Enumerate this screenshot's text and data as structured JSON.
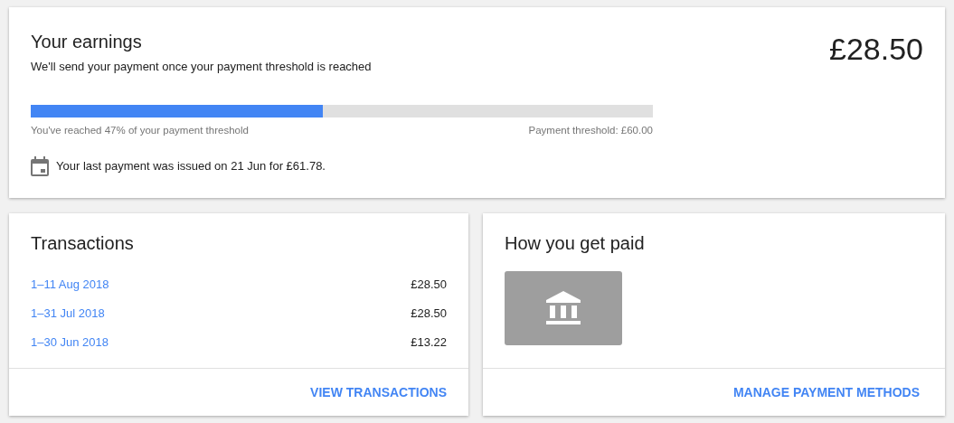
{
  "earnings": {
    "title": "Your earnings",
    "subtitle": "We'll send your payment once your payment threshold is reached",
    "amount": "£28.50",
    "progress": {
      "level": 0.47,
      "reached_text": "You've reached 47% of your payment threshold",
      "threshold_text": "Payment threshold: £60.00"
    },
    "last_payment": "Your last payment was issued on 21 Jun for £61.78."
  },
  "transactions": {
    "title": "Transactions",
    "rows": [
      {
        "period": "1–11 Aug 2018",
        "amount": "£28.50"
      },
      {
        "period": "1–31 Jul 2018",
        "amount": "£28.50"
      },
      {
        "period": "1–30 Jun 2018",
        "amount": "£13.22"
      }
    ],
    "action": "VIEW TRANSACTIONS"
  },
  "payment": {
    "title": "How you get paid",
    "action": "MANAGE PAYMENT METHODS"
  }
}
